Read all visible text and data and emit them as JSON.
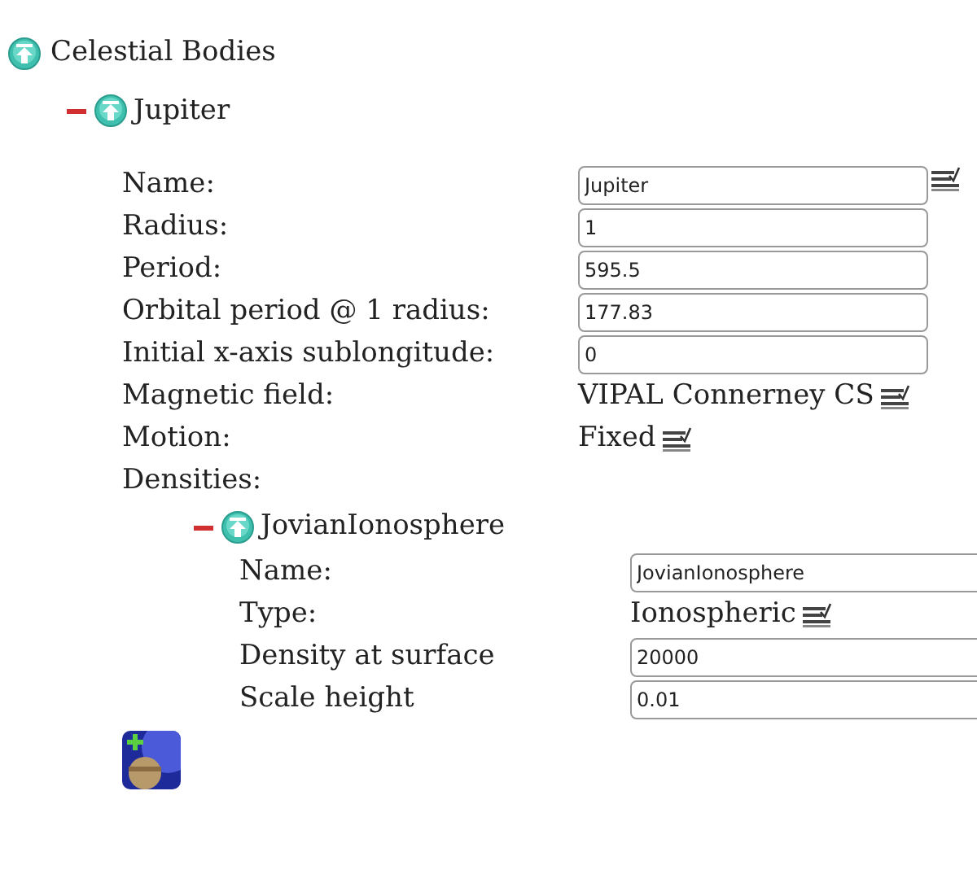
{
  "tree": {
    "label": "Celestial Bodies",
    "children": [
      {
        "label": "Jupiter",
        "expanded": true,
        "fields": [
          {
            "kind": "text",
            "label": "Name:",
            "value": "Jupiter",
            "menu": true
          },
          {
            "kind": "text",
            "label": "Radius:",
            "value": "1",
            "menu": false
          },
          {
            "kind": "text",
            "label": "Period:",
            "value": "595.5",
            "menu": false
          },
          {
            "kind": "text",
            "label": "Orbital period @ 1 radius:",
            "value": "177.83",
            "menu": false
          },
          {
            "kind": "text",
            "label": "Initial x-axis sublongitude:",
            "value": "0",
            "menu": false
          },
          {
            "kind": "choice",
            "label": "Magnetic field:",
            "value": "VIPAL Connerney CS"
          },
          {
            "kind": "choice",
            "label": "Motion:",
            "value": "Fixed"
          }
        ],
        "densities_label": "Densities:",
        "densities": [
          {
            "label": "JovianIonosphere",
            "expanded": true,
            "fields": [
              {
                "kind": "text",
                "label": "Name:",
                "value": "JovianIonosphere",
                "menu": false
              },
              {
                "kind": "choice",
                "label": "Type:",
                "value": "Ionospheric"
              },
              {
                "kind": "text",
                "label": "Density at surface",
                "value": "20000",
                "menu": false
              },
              {
                "kind": "text",
                "label": "Scale height",
                "value": "0.01",
                "menu": false
              }
            ]
          }
        ]
      }
    ]
  }
}
